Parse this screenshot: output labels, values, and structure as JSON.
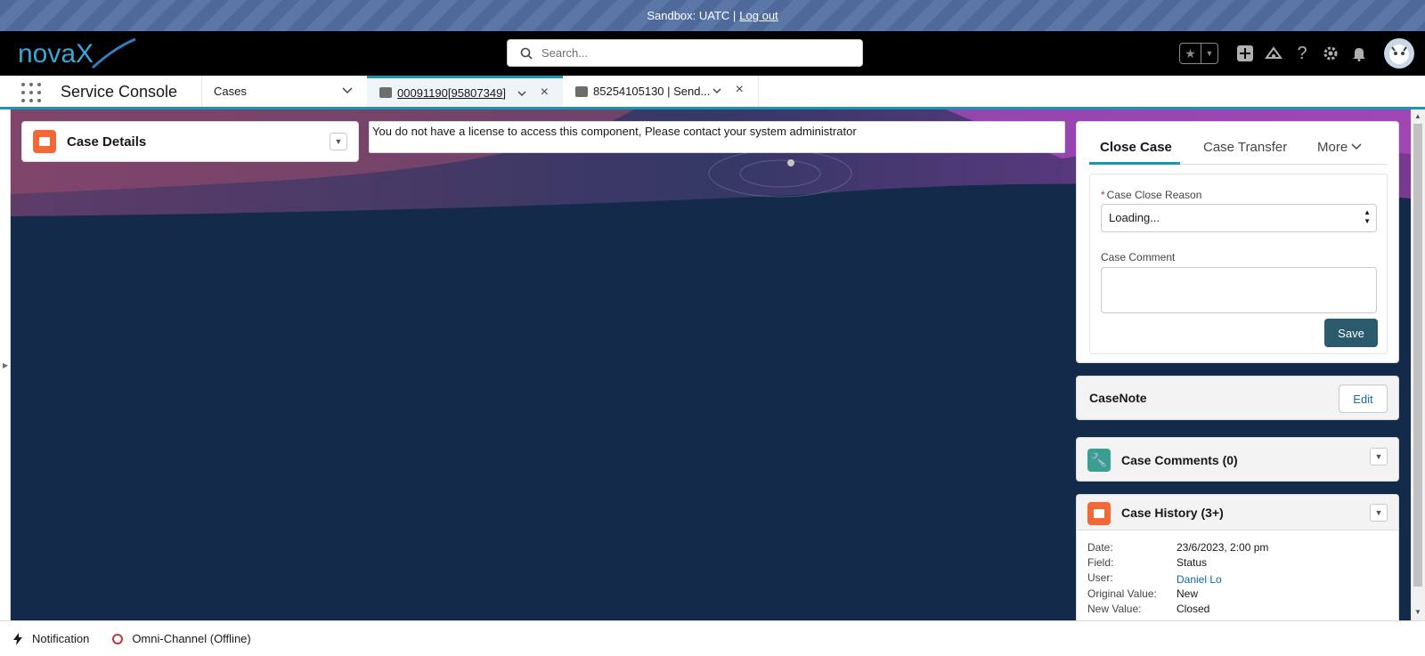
{
  "sandbox": {
    "text": "Sandbox: UATC |",
    "logout": "Log out"
  },
  "header": {
    "logo_text": "novaX",
    "search_placeholder": "Search..."
  },
  "nav": {
    "app_name": "Service Console",
    "object_item": "Cases",
    "tabs": [
      {
        "label": "00091190[95807349]",
        "active": true
      },
      {
        "label": "85254105130 | Send...",
        "active": false
      }
    ]
  },
  "case_details": {
    "title": "Case Details"
  },
  "license_message": "You do not have a license to access this component, Please contact your system administrator",
  "close_case": {
    "tabs": [
      "Close Case",
      "Case Transfer",
      "More"
    ],
    "reason_label": "Case Close Reason",
    "reason_value": "Loading...",
    "comment_label": "Case Comment",
    "save_label": "Save"
  },
  "case_note": {
    "title": "CaseNote",
    "edit_label": "Edit"
  },
  "case_comments": {
    "title": "Case Comments (0)"
  },
  "case_history": {
    "title": "Case History (3+)",
    "rows": [
      {
        "key": "Date:",
        "value": "23/6/2023, 2:00 pm"
      },
      {
        "key": "Field:",
        "value": "Status"
      },
      {
        "key": "User:",
        "value": "Daniel Lo"
      },
      {
        "key": "Original Value:",
        "value": "New"
      },
      {
        "key": "New Value:",
        "value": "Closed"
      }
    ]
  },
  "utility": {
    "notification": "Notification",
    "omni": "Omni-Channel (Offline)"
  },
  "colors": {
    "accent": "#1b96b1",
    "brand_orange": "#f26937",
    "save_button": "#2a5a6b",
    "background": "#132a4a"
  }
}
